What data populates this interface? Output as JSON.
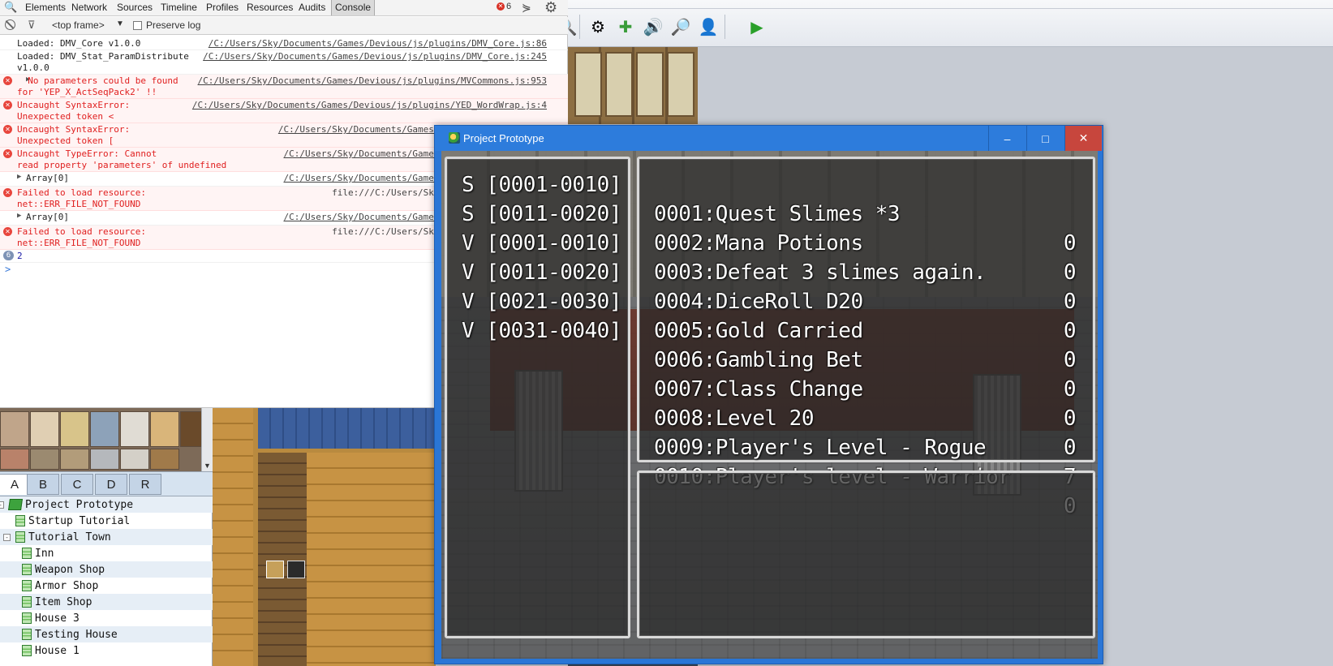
{
  "devtools": {
    "tabs": [
      "Elements",
      "Network",
      "Sources",
      "Timeline",
      "Profiles",
      "Resources",
      "Audits",
      "Console"
    ],
    "active_tab": "Console",
    "error_count": "6",
    "filter": {
      "frame": "<top frame>",
      "preserve_log": "Preserve log"
    },
    "messages": [
      {
        "type": "log",
        "text": "Loaded: DMV_Core v1.0.0",
        "source": "/C:/Users/Sky/Documents/Games/Devious/js/plugins/DMV_Core.js:86"
      },
      {
        "type": "log",
        "text": "Loaded: DMV_Stat_ParamDistribute\nv1.0.0",
        "source": "/C:/Users/Sky/Documents/Games/Devious/js/plugins/DMV_Core.js:245"
      },
      {
        "type": "error",
        "text": "  No parameters could be found\nfor 'YEP_X_ActSeqPack2' !!",
        "source": "/C:/Users/Sky/Documents/Games/Devious/js/plugins/MVCommons.js:953"
      },
      {
        "type": "error",
        "text": "Uncaught SyntaxError:\nUnexpected token <",
        "source": "/C:/Users/Sky/Documents/Games/Devious/js/plugins/YED_WordWrap.js:4"
      },
      {
        "type": "error",
        "text": "Uncaught SyntaxError:\nUnexpected token [",
        "source": "/C:/Users/Sky/Documents/Games/Devious/js/plugins/N"
      },
      {
        "type": "error",
        "text": "Uncaught TypeError: Cannot\nread property 'parameters' of undefined",
        "source": "/C:/Users/Sky/Documents/Games/Devious/js/plugins/"
      },
      {
        "type": "array",
        "text": "Array[0]",
        "source": "/C:/Users/Sky/Documents/Games/Devious/js/plugins/"
      },
      {
        "type": "error",
        "text": "Failed to load resource:\nnet::ERR_FILE_NOT_FOUND",
        "source": "file:///C:/Users/Sky/Documents/Games/Dev"
      },
      {
        "type": "array",
        "text": "Array[0]",
        "source": "/C:/Users/Sky/Documents/Games/Devious/js/plugins/"
      },
      {
        "type": "error",
        "text": "Failed to load resource:\nnet::ERR_FILE_NOT_FOUND",
        "source": "file:///C:/Users/Sky/Documents/Games/Dev"
      },
      {
        "type": "number",
        "count": "6",
        "text": "2",
        "source": ""
      }
    ],
    "prompt": ">"
  },
  "editor": {
    "tileset_tabs": [
      "A",
      "B",
      "C",
      "D",
      "R"
    ],
    "active_tileset_tab": "A",
    "map_tree": [
      {
        "label": "Project Prototype",
        "level": 0,
        "kind": "project",
        "expander": "-"
      },
      {
        "label": "Startup Tutorial",
        "level": 1,
        "kind": "map"
      },
      {
        "label": "Tutorial Town",
        "level": 1,
        "kind": "map",
        "expander": "-"
      },
      {
        "label": "Inn",
        "level": 2,
        "kind": "map"
      },
      {
        "label": "Weapon Shop",
        "level": 2,
        "kind": "map"
      },
      {
        "label": "Armor Shop",
        "level": 2,
        "kind": "map"
      },
      {
        "label": "Item Shop",
        "level": 2,
        "kind": "map"
      },
      {
        "label": "House 3",
        "level": 2,
        "kind": "map"
      },
      {
        "label": "Testing House",
        "level": 2,
        "kind": "map"
      },
      {
        "label": "House 1",
        "level": 2,
        "kind": "map"
      }
    ]
  },
  "game_window": {
    "title": "Project Prototype",
    "buttons": {
      "minimize": "–",
      "maximize": "□",
      "close": "✕"
    },
    "ranges": [
      "S [0001-0010]",
      "S [0011-0020]",
      "V [0001-0010]",
      "V [0011-0020]",
      "V [0021-0030]",
      "V [0031-0040]"
    ],
    "variables": [
      {
        "name": "0001:Quest Slimes *3",
        "value": "0"
      },
      {
        "name": "0002:Mana Potions",
        "value": "0"
      },
      {
        "name": "0003:Defeat 3 slimes again.",
        "value": "0"
      },
      {
        "name": "0004:DiceRoll D20",
        "value": "0"
      },
      {
        "name": "0005:Gold Carried",
        "value": "0"
      },
      {
        "name": "0006:Gambling Bet",
        "value": "0"
      },
      {
        "name": "0007:Class Change",
        "value": "0"
      },
      {
        "name": "0008:Level 20",
        "value": "0"
      },
      {
        "name": "0009:Player's Level - Rogue",
        "value": "7"
      },
      {
        "name": "0010:Player's level - Warrior",
        "value": "0"
      }
    ]
  },
  "colors": {
    "console_error": "#e02020",
    "window_titlebar": "#2d7cdc",
    "close_button": "#c7463d"
  }
}
